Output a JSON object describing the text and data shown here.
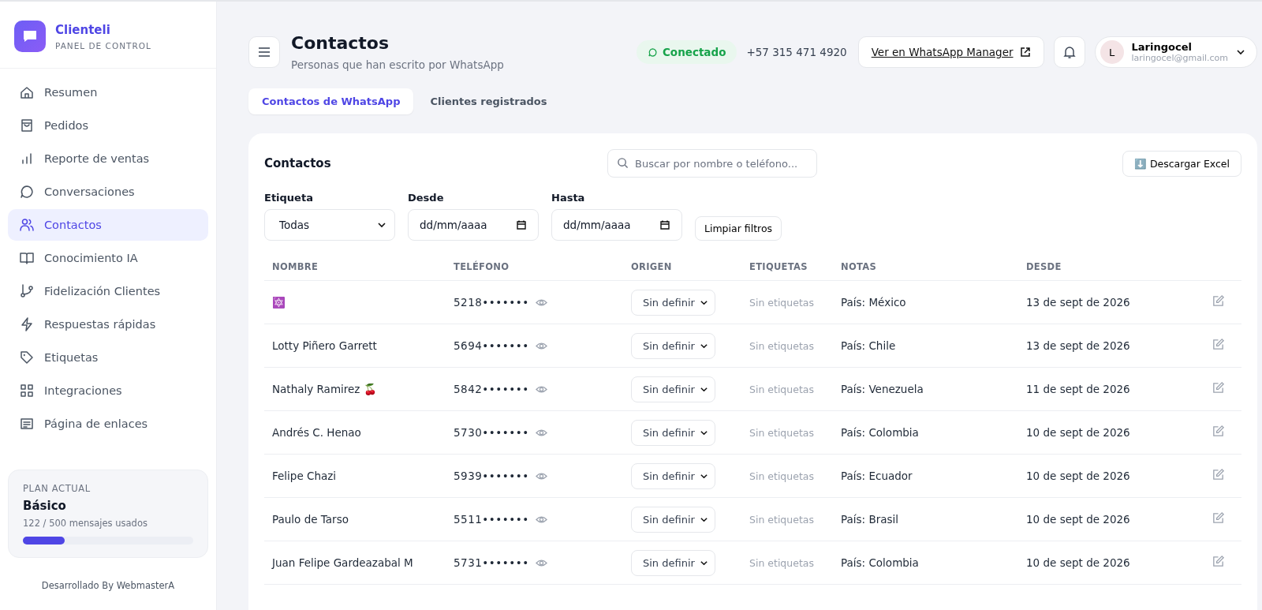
{
  "brand": {
    "name": "Clienteli",
    "subtitle": "PANEL DE CONTROL"
  },
  "sidebar": {
    "items": [
      {
        "label": "Resumen",
        "selected": false
      },
      {
        "label": "Pedidos",
        "selected": false
      },
      {
        "label": "Reporte de ventas",
        "selected": false
      },
      {
        "label": "Conversaciones",
        "selected": false
      },
      {
        "label": "Contactos",
        "selected": true
      },
      {
        "label": "Conocimiento IA",
        "selected": false
      },
      {
        "label": "Fidelización Clientes",
        "selected": false
      },
      {
        "label": "Respuestas rápidas",
        "selected": false
      },
      {
        "label": "Etiquetas",
        "selected": false
      },
      {
        "label": "Integraciones",
        "selected": false
      },
      {
        "label": "Página de enlaces",
        "selected": false
      }
    ]
  },
  "plan": {
    "caption": "PLAN ACTUAL",
    "name": "Básico",
    "usage": "122 / 500 mensajes usados",
    "level": 0.244
  },
  "footer": "Desarrollado By WebmasterA",
  "header": {
    "title": "Contactos",
    "subtitle": "Personas que han escrito por WhatsApp",
    "status": "Conectado",
    "phone": "+57 315 471 4920",
    "manager_link": "Ver en WhatsApp Manager",
    "user": {
      "initial": "L",
      "name": "Laringocel",
      "email": "laringocel@gmail.com"
    }
  },
  "tabs": [
    {
      "label": "Contactos de WhatsApp",
      "selected": true
    },
    {
      "label": "Clientes registrados",
      "selected": false
    }
  ],
  "card": {
    "title": "Contactos",
    "search": {
      "placeholder": "Buscar por nombre o teléfono..."
    },
    "download": {
      "icon": "⬇️",
      "label": "Descargar Excel"
    },
    "filters": {
      "tag_label": "Etiqueta",
      "tag_value": "Todas",
      "from_label": "Desde",
      "from_placeholder": "dd/mm/aaaa",
      "to_label": "Hasta",
      "to_placeholder": "dd/mm/aaaa",
      "clear": "Limpiar filtros"
    }
  },
  "table": {
    "columns": [
      "NOMBRE",
      "TELÉFONO",
      "ORIGEN",
      "ETIQUETAS",
      "NOTAS",
      "DESDE"
    ],
    "rows": [
      {
        "name": "🔯",
        "phone": "5218•••••••",
        "origin": "Sin definir",
        "tags": "Sin etiquetas",
        "notes": "País: México",
        "since": "13 de sept de 2026"
      },
      {
        "name": "Lotty Piñero Garrett",
        "phone": "5694•••••••",
        "origin": "Sin definir",
        "tags": "Sin etiquetas",
        "notes": "País: Chile",
        "since": "13 de sept de 2026"
      },
      {
        "name": "Nathaly Ramirez 🍒",
        "phone": "5842•••••••",
        "origin": "Sin definir",
        "tags": "Sin etiquetas",
        "notes": "País: Venezuela",
        "since": "11 de sept de 2026"
      },
      {
        "name": "Andrés C. Henao",
        "phone": "5730•••••••",
        "origin": "Sin definir",
        "tags": "Sin etiquetas",
        "notes": "País: Colombia",
        "since": "10 de sept de 2026"
      },
      {
        "name": "Felipe Chazi",
        "phone": "5939•••••••",
        "origin": "Sin definir",
        "tags": "Sin etiquetas",
        "notes": "País: Ecuador",
        "since": "10 de sept de 2026"
      },
      {
        "name": "Paulo de Tarso",
        "phone": "5511•••••••",
        "origin": "Sin definir",
        "tags": "Sin etiquetas",
        "notes": "País: Brasil",
        "since": "10 de sept de 2026"
      },
      {
        "name": "Juan Felipe Gardeazabal M",
        "phone": "5731•••••••",
        "origin": "Sin definir",
        "tags": "Sin etiquetas",
        "notes": "País: Colombia",
        "since": "10 de sept de 2026"
      }
    ]
  }
}
